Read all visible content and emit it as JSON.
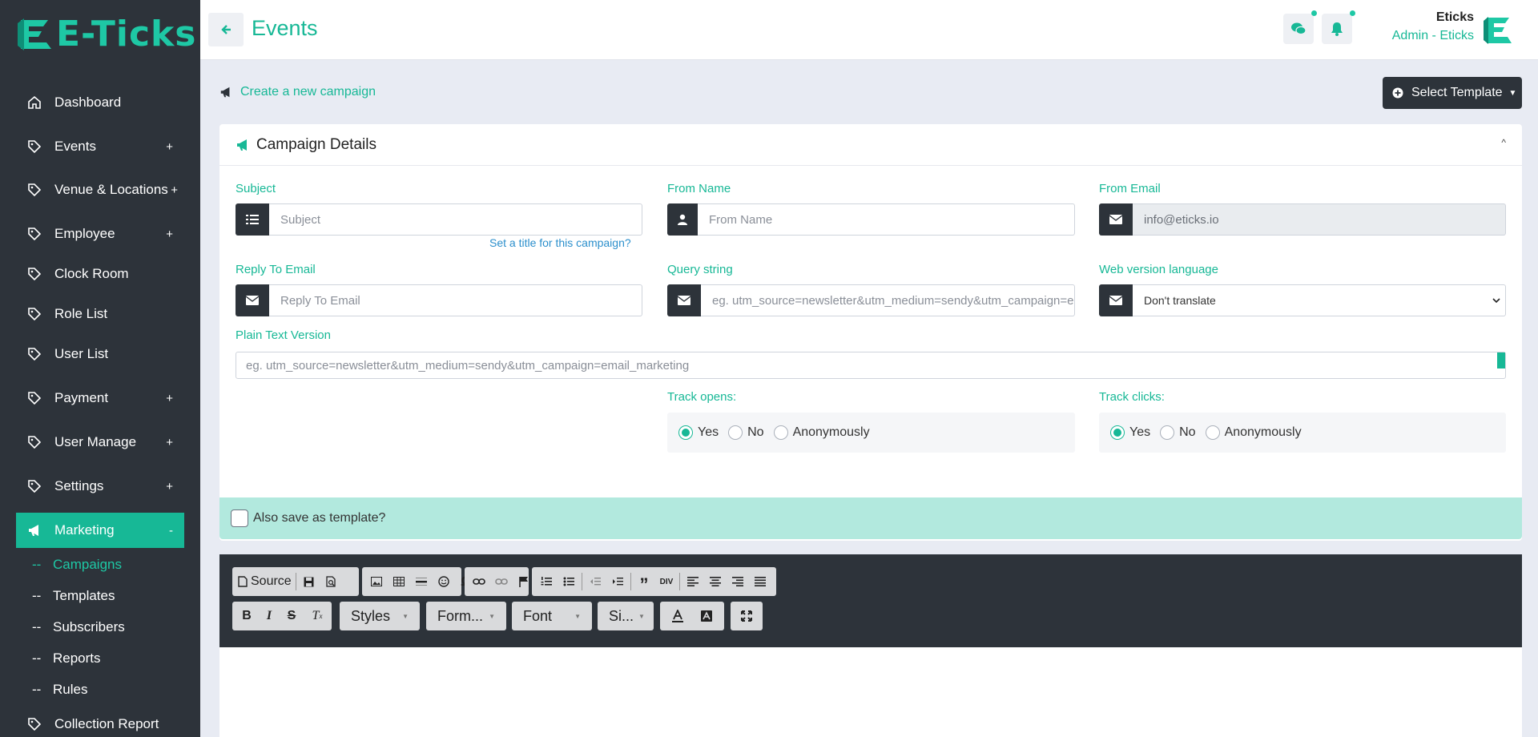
{
  "brand": {
    "name": "E-Ticks",
    "accent": "#17b896",
    "dark": "#2d333a"
  },
  "header": {
    "title": "Events",
    "user_name": "Eticks",
    "user_role": "Admin - Eticks"
  },
  "sidebar": {
    "items": [
      {
        "label": "Dashboard",
        "icon": "home-icon",
        "plus": ""
      },
      {
        "label": "Events",
        "icon": "tag-icon",
        "plus": "+"
      },
      {
        "label": "Venue & Locations",
        "icon": "tag-icon",
        "plus": "+"
      },
      {
        "label": "Employee",
        "icon": "tag-icon",
        "plus": "+"
      },
      {
        "label": "Clock Room",
        "icon": "tag-icon",
        "plus": ""
      },
      {
        "label": "Role List",
        "icon": "tag-icon",
        "plus": ""
      },
      {
        "label": "User List",
        "icon": "tag-icon",
        "plus": ""
      },
      {
        "label": "Payment",
        "icon": "tag-icon",
        "plus": "+"
      },
      {
        "label": "User Manage",
        "icon": "tag-icon",
        "plus": "+"
      },
      {
        "label": "Settings",
        "icon": "tag-icon",
        "plus": "+"
      },
      {
        "label": "Marketing",
        "icon": "megaphone-icon",
        "plus": "-"
      }
    ],
    "subitems": [
      {
        "dash": "--",
        "label": "Campaigns"
      },
      {
        "dash": "--",
        "label": "Templates"
      },
      {
        "dash": "--",
        "label": "Subscribers"
      },
      {
        "dash": "--",
        "label": "Reports"
      },
      {
        "dash": "--",
        "label": "Rules"
      }
    ],
    "last_item": {
      "label": "Collection Report",
      "icon": "tag-icon"
    }
  },
  "content": {
    "create_link": "Create a new campaign",
    "select_template": "Select Template"
  },
  "card": {
    "title": "Campaign Details",
    "subject": {
      "label": "Subject",
      "placeholder": "Subject",
      "help": "Set a title for this campaign?"
    },
    "from_name": {
      "label": "From Name",
      "placeholder": "From Name"
    },
    "from_email": {
      "label": "From Email",
      "value": "info@eticks.io"
    },
    "reply_to": {
      "label": "Reply To Email",
      "placeholder": "Reply To Email"
    },
    "query_string": {
      "label": "Query string",
      "placeholder": "eg. utm_source=newsletter&utm_medium=sendy&utm_campaign=email_marketing"
    },
    "web_lang": {
      "label": "Web version language",
      "value": "Don't translate"
    },
    "plain_text": {
      "label": "Plain Text Version",
      "placeholder": "eg. utm_source=newsletter&utm_medium=sendy&utm_campaign=email_marketing"
    },
    "track_opens": {
      "label": "Track opens:",
      "options": [
        "Yes",
        "No",
        "Anonymously"
      ],
      "selected": "Yes"
    },
    "track_clicks": {
      "label": "Track clicks:",
      "options": [
        "Yes",
        "No",
        "Anonymously"
      ],
      "selected": "Yes"
    },
    "save_template": "Also save as template?"
  },
  "editor": {
    "source_label": "Source",
    "styles": "Styles",
    "format": "Form...",
    "font": "Font",
    "size": "Si..."
  }
}
